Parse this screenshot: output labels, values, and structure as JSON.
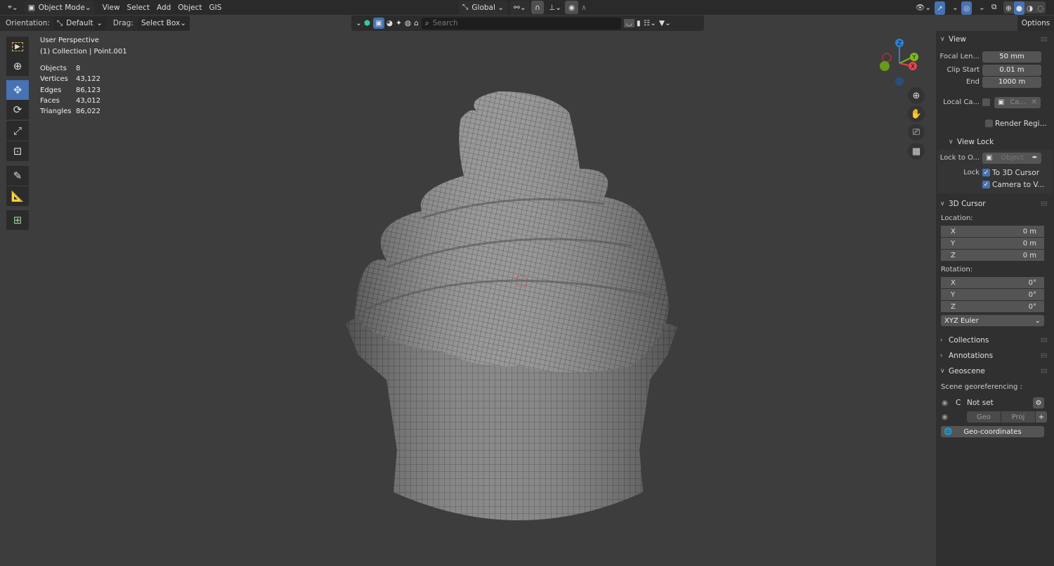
{
  "header": {
    "mode": "Object Mode",
    "menus": [
      "View",
      "Select",
      "Add",
      "Object",
      "GIS"
    ],
    "orientation_label": "Global",
    "search_placeholder": "Search",
    "options": "Options"
  },
  "toolsettings": {
    "orientation_label": "Orientation:",
    "orientation_value": "Default",
    "drag_label": "Drag:",
    "drag_value": "Select Box"
  },
  "viewport": {
    "view_name": "User Perspective",
    "collection": "(1) Collection | Point.001",
    "stats": [
      {
        "label": "Objects",
        "value": "8"
      },
      {
        "label": "Vertices",
        "value": "43,122"
      },
      {
        "label": "Edges",
        "value": "86,123"
      },
      {
        "label": "Faces",
        "value": "43,012"
      },
      {
        "label": "Triangles",
        "value": "86,022"
      }
    ],
    "axes": {
      "x": "X",
      "y": "Y",
      "z": "Z"
    }
  },
  "sidebar": {
    "view": {
      "title": "View",
      "focal_label": "Focal Len...",
      "focal": "50 mm",
      "clip_start_label": "Clip Start",
      "clip_start": "0.01 m",
      "end_label": "End",
      "end": "1000 m",
      "local_cam_label": "Local Ca...",
      "local_cam_value": "Ca...",
      "render_region": "Render Regi..."
    },
    "view_lock": {
      "title": "View Lock",
      "lock_obj_label": "Lock to O...",
      "lock_obj_placeholder": "Object",
      "lock_label": "Lock",
      "to_cursor": "To 3D Cursor",
      "cam_to_view": "Camera to V...",
      "to_cursor_checked": true,
      "cam_to_view_checked": true
    },
    "cursor": {
      "title": "3D Cursor",
      "location_label": "Location:",
      "location": [
        {
          "axis": "X",
          "value": "0 m"
        },
        {
          "axis": "Y",
          "value": "0 m"
        },
        {
          "axis": "Z",
          "value": "0 m"
        }
      ],
      "rotation_label": "Rotation:",
      "rotation": [
        {
          "axis": "X",
          "value": "0°"
        },
        {
          "axis": "Y",
          "value": "0°"
        },
        {
          "axis": "Z",
          "value": "0°"
        }
      ],
      "rotation_mode": "XYZ Euler"
    },
    "collections": "Collections",
    "annotations": "Annotations",
    "geoscene": {
      "title": "Geoscene",
      "georef_label": "Scene georeferencing :",
      "crs_letter": "C",
      "crs_value": "Not set",
      "geo": "Geo",
      "proj": "Proj",
      "geo_coords": "Geo-coordinates"
    }
  },
  "colors": {
    "accent": "#4772b3",
    "background": "#3d3d3d",
    "x_axis": "#e8414f",
    "y_axis": "#7dbb1a",
    "z_axis": "#2e7fd6"
  }
}
